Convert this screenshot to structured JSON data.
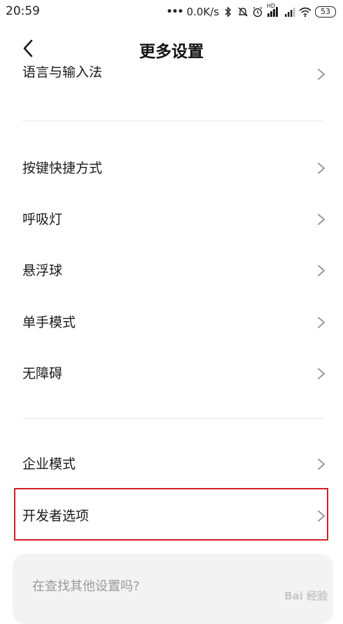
{
  "status_bar": {
    "time": "20:59",
    "dots": "•••",
    "speed": "0.0K/s",
    "hd_label": "HD",
    "battery": "53"
  },
  "header": {
    "title": "更多设置"
  },
  "rows": {
    "language": "语言与输入法",
    "shortcut": "按键快捷方式",
    "breathing_light": "呼吸灯",
    "floating_ball": "悬浮球",
    "one_hand": "单手模式",
    "accessibility": "无障碍",
    "enterprise": "企业模式",
    "developer": "开发者选项"
  },
  "search": {
    "placeholder": "在查找其他设置吗?"
  },
  "watermark": "Bai 经验",
  "colors": {
    "highlight": "#d0202a",
    "search_bg": "#f3f3f3"
  }
}
